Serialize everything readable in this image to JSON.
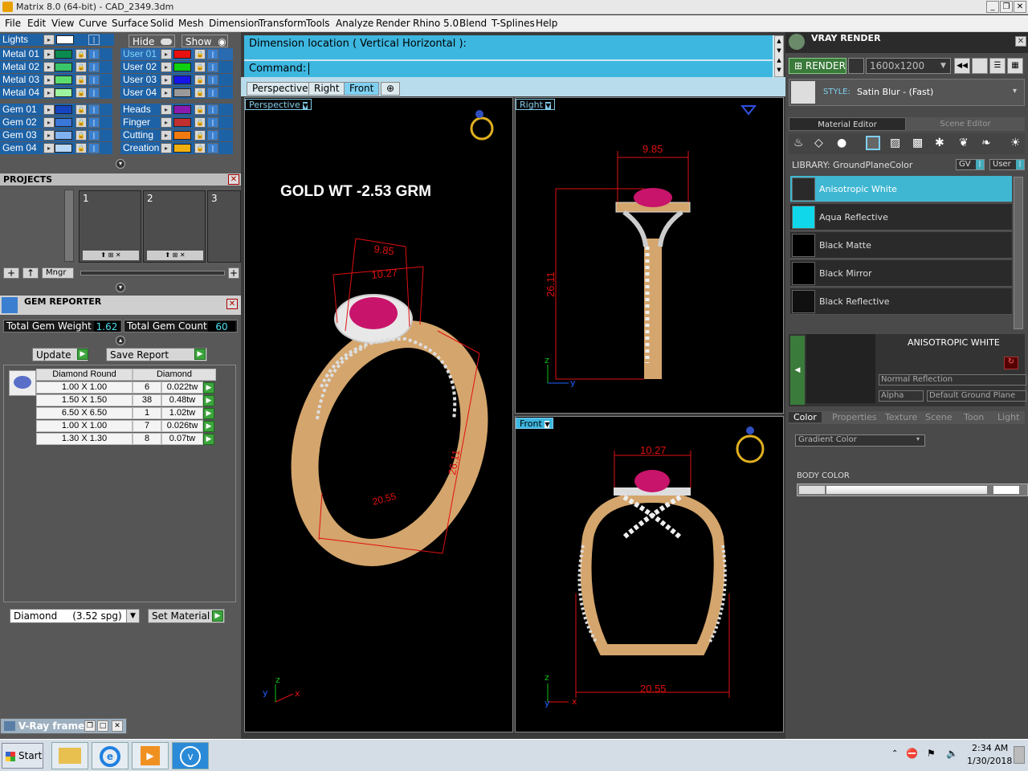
{
  "window": {
    "title": "Matrix 8.0 (64-bit) - CAD_2349.3dm"
  },
  "menu": [
    "File",
    "Edit",
    "View",
    "Curve",
    "Surface",
    "Solid",
    "Mesh",
    "Dimension",
    "Transform",
    "Tools",
    "Analyze",
    "Render",
    "Rhino 5.0",
    "Blend",
    "T-Splines",
    "Help"
  ],
  "layers": {
    "lights": "Lights",
    "hide": "Hide",
    "show": "Show",
    "left": [
      {
        "name": "Metal 01",
        "color": "#0a8a4e"
      },
      {
        "name": "Metal 02",
        "color": "#3ac46a"
      },
      {
        "name": "Metal 03",
        "color": "#5ddc6e"
      },
      {
        "name": "Metal 04",
        "color": "#9ef5a0"
      },
      {
        "name": "Gem 01",
        "color": "#1545c0"
      },
      {
        "name": "Gem 02",
        "color": "#3a77d8"
      },
      {
        "name": "Gem 03",
        "color": "#7fb2f0"
      },
      {
        "name": "Gem 04",
        "color": "#b8d7f7"
      }
    ],
    "right": [
      {
        "name": "User 01",
        "color": "#e81010"
      },
      {
        "name": "User 02",
        "color": "#10d010"
      },
      {
        "name": "User 03",
        "color": "#1515e8"
      },
      {
        "name": "User 04",
        "color": "#9a9a9a"
      },
      {
        "name": "Heads",
        "color": "#8a1ab0"
      },
      {
        "name": "Finger",
        "color": "#c03030"
      },
      {
        "name": "Cutting",
        "color": "#f07a10"
      },
      {
        "name": "Creation",
        "color": "#f0b010"
      }
    ]
  },
  "projects": {
    "title": "PROJECTS",
    "slots": [
      "1",
      "2",
      "3"
    ],
    "mngr": "Mngr"
  },
  "gem_reporter": {
    "title": "GEM REPORTER",
    "weight_label": "Total Gem Weight",
    "weight": "1.62",
    "count_label": "Total Gem Count",
    "count": "60",
    "update": "Update",
    "save": "Save Report",
    "headers": [
      "Diamond Round",
      "Diamond"
    ],
    "rows": [
      [
        "1.00 X 1.00",
        "6",
        "0.022tw"
      ],
      [
        "1.50 X 1.50",
        "38",
        "0.48tw"
      ],
      [
        "6.50 X 6.50",
        "1",
        "1.02tw"
      ],
      [
        "1.00 X 1.00",
        "7",
        "0.026tw"
      ],
      [
        "1.30 X 1.30",
        "8",
        "0.07tw"
      ]
    ],
    "material": "Diamond     (3.52 spg)",
    "set_material": "Set Material"
  },
  "command": {
    "prompt": "Dimension location ( Vertical  Horizontal ):",
    "label": "Command:"
  },
  "tabs": [
    "Perspective",
    "Right",
    "Front"
  ],
  "viewports": {
    "perspective": {
      "label": "Perspective",
      "note": "GOLD WT -2.53 GRM",
      "dims": [
        "9.85",
        "10.27",
        "26.11",
        "20.55"
      ]
    },
    "right": {
      "label": "Right",
      "dims": [
        "9.85",
        "26.11"
      ]
    },
    "front": {
      "label": "Front",
      "dims": [
        "10.27",
        "20.55"
      ]
    }
  },
  "vray": {
    "title": "VRAY RENDER",
    "render": "RENDER",
    "resolution": "1600x1200",
    "style_label": "STYLE:",
    "style": "Satin Blur - (Fast)",
    "tab_material": "Material Editor",
    "tab_scene": "Scene Editor",
    "library_label": "LIBRARY: GroundPlaneColor",
    "gv": "GV",
    "user": "User",
    "materials": [
      {
        "name": "Anisotropic White",
        "swatch": "#2a2a2a"
      },
      {
        "name": "Aqua Reflective",
        "swatch": "#10d8ea"
      },
      {
        "name": "Black Matte",
        "swatch": "#000000"
      },
      {
        "name": "Black Mirror",
        "swatch": "#000000"
      },
      {
        "name": "Black Reflective",
        "swatch": "#101010"
      }
    ],
    "selected_name": "ANISOTROPIC WHITE",
    "reflection": "Normal Reflection",
    "alpha": "Alpha",
    "ground": "Default Ground Plane",
    "prop_tabs": [
      "Color",
      "Properties",
      "Texture",
      "Scene",
      "Toon",
      "Light"
    ],
    "color_mode": "Gradient Color",
    "body_color": "BODY COLOR"
  },
  "vray_frame": {
    "title": "V-Ray frame..."
  },
  "taskbar": {
    "start": "Start",
    "time": "2:34 AM",
    "date": "1/30/2018"
  }
}
